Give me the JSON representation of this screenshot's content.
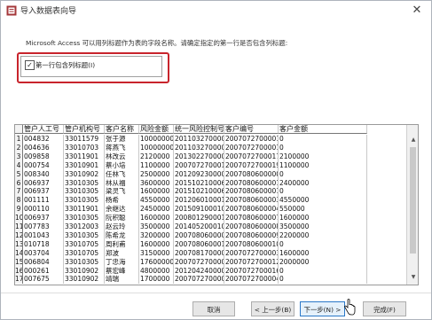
{
  "window": {
    "title": "导入数据表向导",
    "close_glyph": "✕"
  },
  "instruction": "Microsoft Access 可以用列标题作为表的字段名称。请确定指定的第一行是否包含列标题:",
  "header_option": {
    "checkbox_checked": true,
    "check_glyph": "✓",
    "label": "第一行包含列标题(I)"
  },
  "grid": {
    "columns": [
      "管户人工号",
      "管户机构号",
      "客户名称",
      "风险金额",
      "统一风险控制号",
      "客户编号",
      "客户金额"
    ],
    "rows": [
      [
        "1",
        "004832",
        "33011579",
        "张于源",
        "10000000",
        "20110327000059",
        "20070727000015",
        "0"
      ],
      [
        "2",
        "004636",
        "33010703",
        "蒋燕飞",
        "10000000",
        "20110327000059",
        "20070727000016",
        "0"
      ],
      [
        "3",
        "009858",
        "33011901",
        "林改云",
        "2120000",
        "20130227000043",
        "20070727000179",
        "2100000"
      ],
      [
        "4",
        "000754",
        "33010901",
        "蔡小培",
        "1100000",
        "20070727000197",
        "20070727000197",
        "1100000"
      ],
      [
        "5",
        "008340",
        "33010902",
        "任林飞",
        "2500000",
        "20120923000090",
        "20070806000009",
        "0"
      ],
      [
        "6",
        "006937",
        "33010305",
        "林从福",
        "3600000",
        "20151021000685",
        "20070806000015",
        "2400000"
      ],
      [
        "7",
        "006937",
        "33010305",
        "梁灵飞",
        "1600000",
        "20151021000685",
        "20070806000018",
        "0"
      ],
      [
        "8",
        "001111",
        "33010305",
        "杨希",
        "4550000",
        "20120601000126",
        "20070806000038",
        "4550000"
      ],
      [
        "9",
        "000110",
        "33011901",
        "余继达",
        "2450000",
        "20150910001050",
        "20070806000045",
        "550000"
      ],
      [
        "10",
        "006937",
        "33010305",
        "阮积聪",
        "1600000",
        "20080129000154",
        "20070806000079",
        "1600000"
      ],
      [
        "11",
        "007783",
        "33012003",
        "赵云玲",
        "3500000",
        "20140520001019",
        "20070806000084",
        "3500000"
      ],
      [
        "12",
        "001043",
        "33010305",
        "陈希龙",
        "3200000",
        "20070806000090",
        "20070806000090",
        "2200000"
      ],
      [
        "13",
        "010718",
        "33010705",
        "周利甫",
        "1600000",
        "20070806000109",
        "20070806000109",
        "0"
      ],
      [
        "14",
        "003704",
        "33010705",
        "郑波",
        "3150000",
        "20070817000079",
        "20070727000037",
        "1600000"
      ],
      [
        "15",
        "006804",
        "33010305",
        "丁忠海",
        "17600000",
        "20070727000086",
        "20070727000121",
        "2000000"
      ],
      [
        "16",
        "000261",
        "33010902",
        "蔡宏峰",
        "4800000",
        "20120424000065",
        "20070727000162",
        "0"
      ],
      [
        "17",
        "007675",
        "33010902",
        "靖瑞",
        "1700000",
        "20070727000046",
        "20070727000046",
        "0"
      ]
    ]
  },
  "buttons": {
    "cancel": "取消",
    "back": "< 上一步(B)",
    "next": "下一步(N) >",
    "finish": "完成(F)"
  },
  "colors": {
    "highlight": "#c8242c",
    "primary_border": "#2a78c8"
  }
}
